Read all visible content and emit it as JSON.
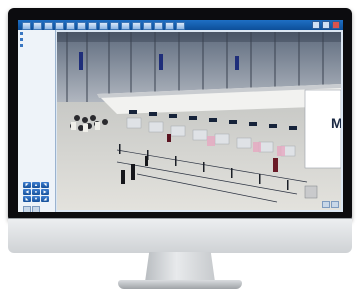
{
  "window": {
    "title_text": "",
    "colors": {
      "titlebar": "#1e6fc4",
      "sidebar": "#eef3f9",
      "ptz_button": "#1f5fb0"
    }
  },
  "toolbar": {
    "buttons": [
      "tool-1",
      "tool-2",
      "tool-3",
      "tool-4",
      "tool-5",
      "tool-6",
      "tool-7",
      "tool-8",
      "tool-9",
      "tool-10",
      "tool-11",
      "tool-12",
      "tool-13",
      "tool-14",
      "tool-15"
    ]
  },
  "sidebar": {
    "tree": [
      {
        "label": "",
        "icon": "camera-group-icon"
      },
      {
        "label": "",
        "icon": "camera-icon"
      },
      {
        "label": "",
        "icon": "camera-icon"
      }
    ]
  },
  "ptz": {
    "buttons": [
      "up-left-arrow-icon",
      "up-arrow-icon",
      "up-right-arrow-icon",
      "left-arrow-icon",
      "center-icon",
      "right-arrow-icon",
      "down-left-arrow-icon",
      "down-arrow-icon",
      "down-right-arrow-icon"
    ],
    "glyphs": [
      "◤",
      "▲",
      "◥",
      "◀",
      "●",
      "▶",
      "◣",
      "▼",
      "◢"
    ]
  },
  "video": {
    "scene": "airport-terminal-check-in-hall-live-view",
    "sign_letter": "M"
  }
}
